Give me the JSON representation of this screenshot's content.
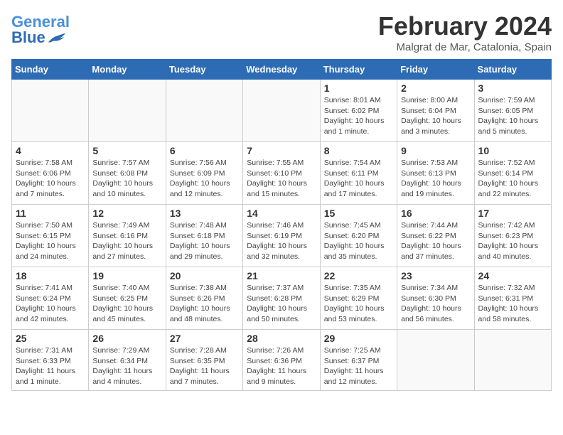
{
  "header": {
    "logo_text1": "General",
    "logo_text2": "Blue",
    "month_year": "February 2024",
    "location": "Malgrat de Mar, Catalonia, Spain"
  },
  "days_of_week": [
    "Sunday",
    "Monday",
    "Tuesday",
    "Wednesday",
    "Thursday",
    "Friday",
    "Saturday"
  ],
  "weeks": [
    [
      {
        "day": "",
        "info": ""
      },
      {
        "day": "",
        "info": ""
      },
      {
        "day": "",
        "info": ""
      },
      {
        "day": "",
        "info": ""
      },
      {
        "day": "1",
        "info": "Sunrise: 8:01 AM\nSunset: 6:02 PM\nDaylight: 10 hours and 1 minute."
      },
      {
        "day": "2",
        "info": "Sunrise: 8:00 AM\nSunset: 6:04 PM\nDaylight: 10 hours and 3 minutes."
      },
      {
        "day": "3",
        "info": "Sunrise: 7:59 AM\nSunset: 6:05 PM\nDaylight: 10 hours and 5 minutes."
      }
    ],
    [
      {
        "day": "4",
        "info": "Sunrise: 7:58 AM\nSunset: 6:06 PM\nDaylight: 10 hours and 7 minutes."
      },
      {
        "day": "5",
        "info": "Sunrise: 7:57 AM\nSunset: 6:08 PM\nDaylight: 10 hours and 10 minutes."
      },
      {
        "day": "6",
        "info": "Sunrise: 7:56 AM\nSunset: 6:09 PM\nDaylight: 10 hours and 12 minutes."
      },
      {
        "day": "7",
        "info": "Sunrise: 7:55 AM\nSunset: 6:10 PM\nDaylight: 10 hours and 15 minutes."
      },
      {
        "day": "8",
        "info": "Sunrise: 7:54 AM\nSunset: 6:11 PM\nDaylight: 10 hours and 17 minutes."
      },
      {
        "day": "9",
        "info": "Sunrise: 7:53 AM\nSunset: 6:13 PM\nDaylight: 10 hours and 19 minutes."
      },
      {
        "day": "10",
        "info": "Sunrise: 7:52 AM\nSunset: 6:14 PM\nDaylight: 10 hours and 22 minutes."
      }
    ],
    [
      {
        "day": "11",
        "info": "Sunrise: 7:50 AM\nSunset: 6:15 PM\nDaylight: 10 hours and 24 minutes."
      },
      {
        "day": "12",
        "info": "Sunrise: 7:49 AM\nSunset: 6:16 PM\nDaylight: 10 hours and 27 minutes."
      },
      {
        "day": "13",
        "info": "Sunrise: 7:48 AM\nSunset: 6:18 PM\nDaylight: 10 hours and 29 minutes."
      },
      {
        "day": "14",
        "info": "Sunrise: 7:46 AM\nSunset: 6:19 PM\nDaylight: 10 hours and 32 minutes."
      },
      {
        "day": "15",
        "info": "Sunrise: 7:45 AM\nSunset: 6:20 PM\nDaylight: 10 hours and 35 minutes."
      },
      {
        "day": "16",
        "info": "Sunrise: 7:44 AM\nSunset: 6:22 PM\nDaylight: 10 hours and 37 minutes."
      },
      {
        "day": "17",
        "info": "Sunrise: 7:42 AM\nSunset: 6:23 PM\nDaylight: 10 hours and 40 minutes."
      }
    ],
    [
      {
        "day": "18",
        "info": "Sunrise: 7:41 AM\nSunset: 6:24 PM\nDaylight: 10 hours and 42 minutes."
      },
      {
        "day": "19",
        "info": "Sunrise: 7:40 AM\nSunset: 6:25 PM\nDaylight: 10 hours and 45 minutes."
      },
      {
        "day": "20",
        "info": "Sunrise: 7:38 AM\nSunset: 6:26 PM\nDaylight: 10 hours and 48 minutes."
      },
      {
        "day": "21",
        "info": "Sunrise: 7:37 AM\nSunset: 6:28 PM\nDaylight: 10 hours and 50 minutes."
      },
      {
        "day": "22",
        "info": "Sunrise: 7:35 AM\nSunset: 6:29 PM\nDaylight: 10 hours and 53 minutes."
      },
      {
        "day": "23",
        "info": "Sunrise: 7:34 AM\nSunset: 6:30 PM\nDaylight: 10 hours and 56 minutes."
      },
      {
        "day": "24",
        "info": "Sunrise: 7:32 AM\nSunset: 6:31 PM\nDaylight: 10 hours and 58 minutes."
      }
    ],
    [
      {
        "day": "25",
        "info": "Sunrise: 7:31 AM\nSunset: 6:33 PM\nDaylight: 11 hours and 1 minute."
      },
      {
        "day": "26",
        "info": "Sunrise: 7:29 AM\nSunset: 6:34 PM\nDaylight: 11 hours and 4 minutes."
      },
      {
        "day": "27",
        "info": "Sunrise: 7:28 AM\nSunset: 6:35 PM\nDaylight: 11 hours and 7 minutes."
      },
      {
        "day": "28",
        "info": "Sunrise: 7:26 AM\nSunset: 6:36 PM\nDaylight: 11 hours and 9 minutes."
      },
      {
        "day": "29",
        "info": "Sunrise: 7:25 AM\nSunset: 6:37 PM\nDaylight: 11 hours and 12 minutes."
      },
      {
        "day": "",
        "info": ""
      },
      {
        "day": "",
        "info": ""
      }
    ]
  ]
}
